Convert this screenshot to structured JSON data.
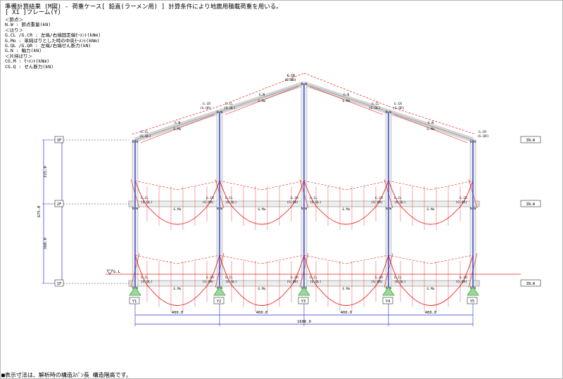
{
  "header": {
    "title": "準備計算結果 (M図) - 荷重ケース[ 鉛直(ラーメン用) ] 計算条件により地震用積載荷重を用いる。",
    "subtitle": "[ X1 ]フレーム(Y)",
    "legend": [
      "＜節点＞",
      "N.W : 節点重量(kN)",
      "＜はり＞",
      "G.CL /G.CR : 左端/右端固定端ﾓｰﾒﾝﾄ(kNm)",
      "G.Mo : 単純ばりとした時の中央ﾓｰﾒﾝﾄ(kNm)",
      "G.QL /G.QR : 左端/右端せん断力(kN)",
      "G.N : 軸力(kN)",
      "＜片持ばり＞",
      "CG.M : ﾓｰﾒﾝﾄ(kNm)",
      "CG.Q : せん断力(kN)"
    ]
  },
  "floors": [
    "3F",
    "2F",
    "1F"
  ],
  "ground_label": "G.L",
  "axes": [
    "Y1",
    "Y2",
    "Y3",
    "Y4",
    "Y5"
  ],
  "story_heights": [
    "315.0",
    "360.0"
  ],
  "total_height": "675.0",
  "spans": [
    "400.0",
    "400.0",
    "400.0",
    "400.0"
  ],
  "total_span": "1600.0",
  "sum_label": "ΣN.W",
  "node_label": "N.W",
  "beam_labels": {
    "cl": "G.CL",
    "cr": "G.CR",
    "ql": "(G.QL)",
    "qr": "(G.QR)",
    "mo": "G.Mo",
    "n": "G.N"
  },
  "footer": "■表示寸法は、解析時の構造ｽﾊﾟﾝ長 構造階高です。",
  "colors": {
    "moment": "#e8201c",
    "column": "#2b3fd6",
    "dimension": "#2b2fd0",
    "support": "#3aa53a",
    "member": "#d4d4d4"
  }
}
